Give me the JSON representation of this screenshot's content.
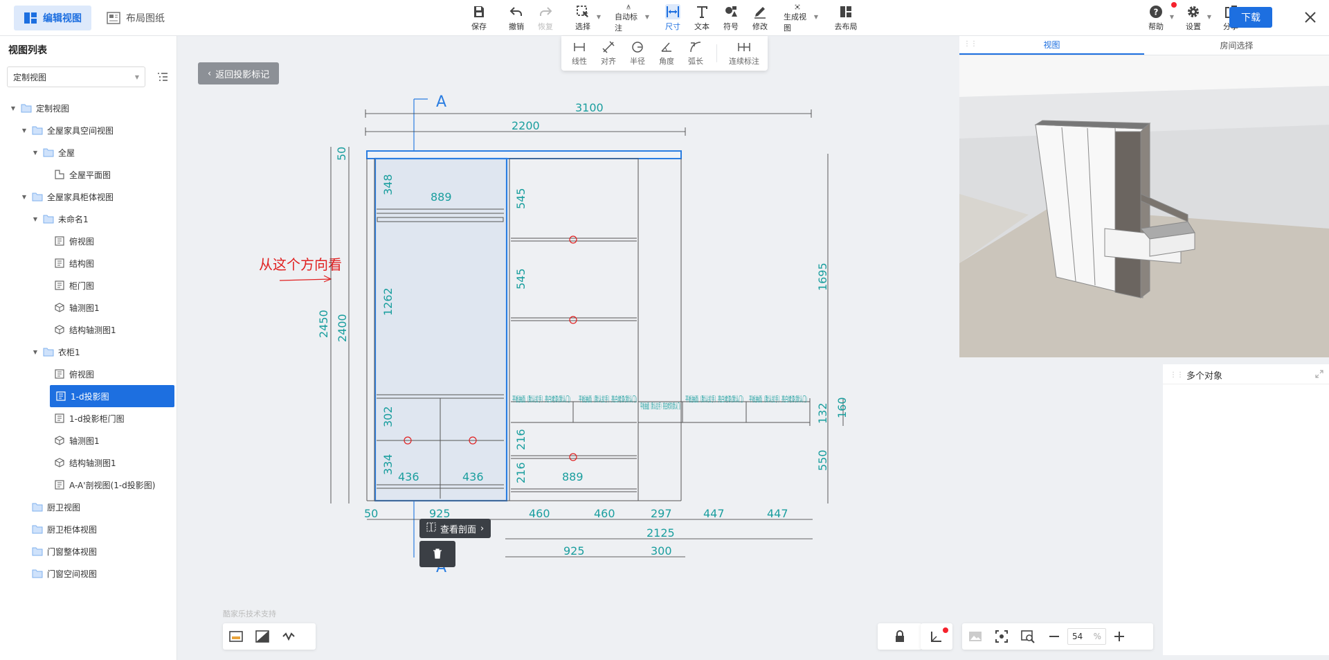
{
  "topbar": {
    "modes": [
      {
        "label": "编辑视图",
        "active": true
      },
      {
        "label": "布局图纸",
        "active": false
      }
    ],
    "tools": [
      {
        "id": "save",
        "label": "保存"
      },
      {
        "id": "undo",
        "label": "撤销"
      },
      {
        "id": "redo",
        "label": "恢复"
      },
      {
        "id": "select",
        "label": "选择"
      },
      {
        "id": "auto-dim",
        "label": "自动标注"
      },
      {
        "id": "dimension",
        "label": "尺寸"
      },
      {
        "id": "text",
        "label": "文本"
      },
      {
        "id": "symbol",
        "label": "符号"
      },
      {
        "id": "modify",
        "label": "修改"
      },
      {
        "id": "generate-view",
        "label": "生成视图"
      },
      {
        "id": "go-layout",
        "label": "去布局"
      }
    ],
    "right_tools": [
      {
        "id": "help",
        "label": "帮助"
      },
      {
        "id": "settings",
        "label": "设置"
      },
      {
        "id": "share",
        "label": "分享"
      }
    ],
    "download_label": "下载"
  },
  "subtoolbar": {
    "tools": [
      {
        "id": "linear",
        "label": "线性"
      },
      {
        "id": "align",
        "label": "对齐"
      },
      {
        "id": "radius",
        "label": "半径"
      },
      {
        "id": "angle",
        "label": "角度"
      },
      {
        "id": "arc",
        "label": "弧长"
      },
      {
        "id": "continuous",
        "label": "连续标注"
      }
    ]
  },
  "sidebar": {
    "title": "视图列表",
    "select_value": "定制视图",
    "tree": [
      {
        "label": "定制视图",
        "level": 0,
        "type": "folder",
        "expanded": true
      },
      {
        "label": "全屋家具空间视图",
        "level": 1,
        "type": "folder",
        "expanded": true
      },
      {
        "label": "全屋",
        "level": 2,
        "type": "folder",
        "expanded": true
      },
      {
        "label": "全屋平面图",
        "level": 3,
        "type": "plan"
      },
      {
        "label": "全屋家具柜体视图",
        "level": 1,
        "type": "folder",
        "expanded": true
      },
      {
        "label": "未命名1",
        "level": 2,
        "type": "folder",
        "expanded": true
      },
      {
        "label": "俯视图",
        "level": 3,
        "type": "view"
      },
      {
        "label": "结构图",
        "level": 3,
        "type": "view"
      },
      {
        "label": "柜门图",
        "level": 3,
        "type": "view"
      },
      {
        "label": "轴测图1",
        "level": 3,
        "type": "iso"
      },
      {
        "label": "结构轴测图1",
        "level": 3,
        "type": "iso"
      },
      {
        "label": "衣柜1",
        "level": 2,
        "type": "folder",
        "expanded": true
      },
      {
        "label": "俯视图",
        "level": 3,
        "type": "view"
      },
      {
        "label": "1-d投影图",
        "level": 3,
        "type": "view",
        "selected": true
      },
      {
        "label": "1-d投影柜门图",
        "level": 3,
        "type": "view"
      },
      {
        "label": "轴测图1",
        "level": 3,
        "type": "iso"
      },
      {
        "label": "结构轴测图1",
        "level": 3,
        "type": "iso"
      },
      {
        "label": "A-A'剖视图(1-d投影图)",
        "level": 3,
        "type": "view"
      },
      {
        "label": "厨卫视图",
        "level": 1,
        "type": "folder"
      },
      {
        "label": "厨卫柜体视图",
        "level": 1,
        "type": "folder"
      },
      {
        "label": "门窗整体视图",
        "level": 1,
        "type": "folder"
      },
      {
        "label": "门窗空间视图",
        "level": 1,
        "type": "folder"
      }
    ]
  },
  "canvas": {
    "back_label": "返回投影标记",
    "annotation_text": "从这个方向看",
    "section_label": "A",
    "view_section_label": "查看剖面",
    "watermark": "酷家乐技术支持",
    "dims": {
      "top_total": "3100",
      "top_cabinet": "2200",
      "top_panel": "50",
      "h_total": "2450",
      "h_inner": "2400",
      "upper_shelf": "348",
      "rod_width": "889",
      "long_hang": "1262",
      "drawer_upper": "302",
      "drawer_lower": "334",
      "drawer_w1": "436",
      "drawer_w2": "436",
      "mid_top": "545",
      "mid_second": "545",
      "mid_drawer1": "216",
      "mid_drawer2": "216",
      "mid_bottom_w": "889",
      "right_h1": "1695",
      "right_h2": "132",
      "right_h3": "160",
      "right_h4": "550",
      "bot_50": "50",
      "bot_925": "925",
      "bot_460a": "460",
      "bot_460b": "460",
      "bot_297": "297",
      "bot_447a": "447",
      "bot_447b": "447",
      "bot_2125": "2125",
      "bot_925b": "925",
      "bot_300": "300"
    },
    "drawer_labels": [
      "平板抽面（默认拉手）亮白烤漆(默认门)",
      "平板抽面（默认拉手）亮白烤漆(默认门)",
      "平板抽面（默认拉手）亮白烤漆(默认门)",
      "平板抽面（默认拉手）亮白烤漆(默认门)",
      "平板抽面（默认拉手）亮白烤漆(默认门)"
    ],
    "zoom_value": "54",
    "zoom_unit": "%"
  },
  "view_panel": {
    "tabs": [
      {
        "label": "视图",
        "active": true
      },
      {
        "label": "房间选择",
        "active": false
      }
    ]
  },
  "object_panel": {
    "title": "多个对象"
  },
  "colors": {
    "accent": "#1d6fe0",
    "dimension": "#1a9e9e",
    "annotation": "#e02020",
    "selection": "#2a7de1"
  }
}
